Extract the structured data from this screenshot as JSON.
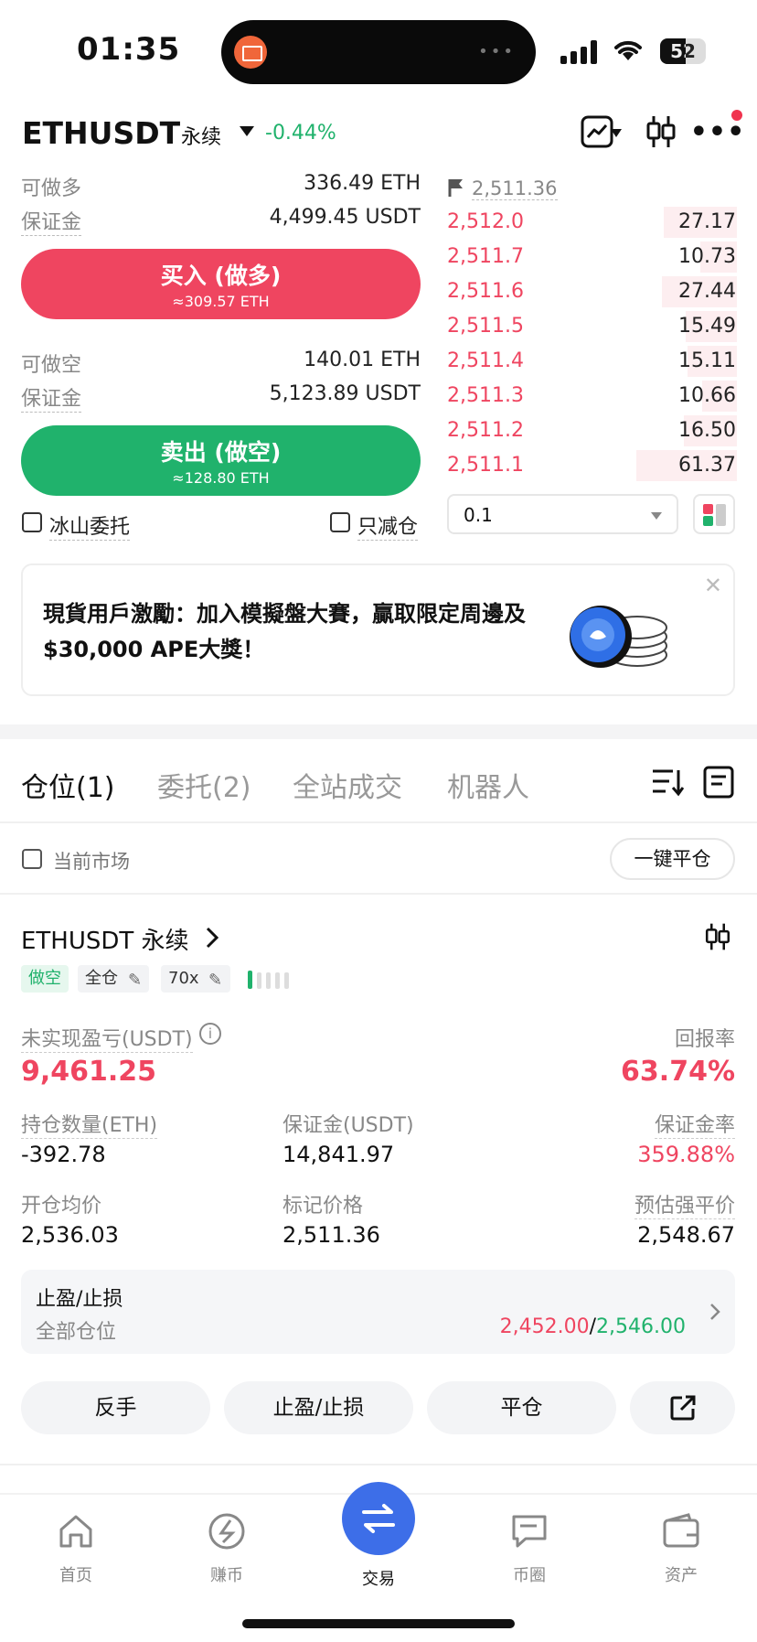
{
  "status_bar": {
    "time": "01:35",
    "battery": "52"
  },
  "header": {
    "symbol": "ETHUSDT",
    "contract_type": "永续",
    "change": "-0.44%"
  },
  "trade_panel": {
    "long_available_label": "可做多",
    "long_available_value": "336.49 ETH",
    "long_margin_label": "保证金",
    "long_margin_value": "4,499.45 USDT",
    "buy_label": "买入 (做多)",
    "buy_sub": "≈309.57 ETH",
    "short_available_label": "可做空",
    "short_available_value": "140.01 ETH",
    "short_margin_label": "保证金",
    "short_margin_value": "5,123.89 USDT",
    "sell_label": "卖出 (做空)",
    "sell_sub": "≈128.80 ETH",
    "iceberg_label": "冰山委托",
    "reduce_only_label": "只减仓"
  },
  "order_book": {
    "mark_price": "2,511.36",
    "asks": [
      {
        "price": "2,512.0",
        "qty": "27.17"
      },
      {
        "price": "2,511.7",
        "qty": "10.73"
      },
      {
        "price": "2,511.6",
        "qty": "27.44"
      },
      {
        "price": "2,511.5",
        "qty": "15.49"
      },
      {
        "price": "2,511.4",
        "qty": "15.11"
      },
      {
        "price": "2,511.3",
        "qty": "10.66"
      },
      {
        "price": "2,511.2",
        "qty": "16.50"
      },
      {
        "price": "2,511.1",
        "qty": "61.37"
      }
    ],
    "precision": "0.1"
  },
  "banner": {
    "text": "現貨用戶激勵：加入模擬盤大賽，贏取限定周邊及$30,000 APE大獎！"
  },
  "tabs": [
    "仓位(1)",
    "委托(2)",
    "全站成交",
    "机器人"
  ],
  "filter": {
    "current_market_label": "当前市场",
    "close_all_label": "一键平仓"
  },
  "position": {
    "title": "ETHUSDT 永续",
    "side_tag": "做空",
    "margin_mode_tag": "全仓",
    "leverage_tag": "70x",
    "upl_label": "未实现盈亏(USDT)",
    "upl_value": "9,461.25",
    "roe_label": "回报率",
    "roe_value": "63.74%",
    "size_label": "持仓数量(ETH)",
    "size_value": "-392.78",
    "margin_label": "保证金(USDT)",
    "margin_value": "14,841.97",
    "margin_ratio_label": "保证金率",
    "margin_ratio_value": "359.88%",
    "entry_label": "开仓均价",
    "entry_value": "2,536.03",
    "mark_label": "标记价格",
    "mark_value": "2,511.36",
    "liq_label": "预估强平价",
    "liq_value": "2,548.67",
    "tpsl_title": "止盈/止损",
    "tpsl_scope": "全部仓位",
    "tpsl_tp": "2,452.00",
    "tpsl_sep": "/",
    "tpsl_sl": "2,546.00",
    "actions": [
      "反手",
      "止盈/止损",
      "平仓"
    ]
  },
  "nav": [
    "首页",
    "赚币",
    "交易",
    "币圈",
    "资产"
  ],
  "colors": {
    "red": "#ef4560",
    "green": "#20b26c",
    "accent": "#3d6ee8"
  }
}
